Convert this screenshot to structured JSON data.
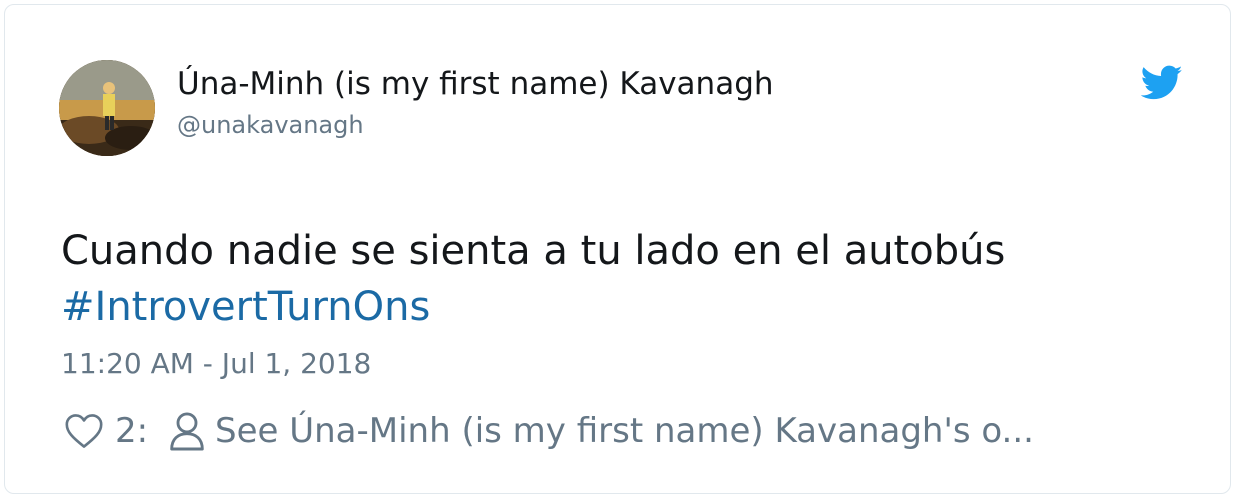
{
  "tweet": {
    "author_name": "Úna-Minh (is my first name) Kavanagh",
    "author_handle": "@unakavanagh",
    "text": "Cuando nadie se sienta a tu lado en el autobús",
    "hashtag": "#IntrovertTurnOns",
    "timestamp": "11:20 AM - Jul 1, 2018",
    "like_count": "2:",
    "see_profile_label": "See Úna-Minh (is my first name) Kavanagh's o..."
  },
  "icons": {
    "brand": "twitter-bird-icon",
    "like": "heart-icon",
    "profile": "person-icon"
  },
  "colors": {
    "brand_blue": "#1da1f2",
    "hashtag_blue": "#1b6aa5",
    "text_primary": "#14171a",
    "text_secondary": "#657786",
    "border": "#e1e8ed"
  }
}
